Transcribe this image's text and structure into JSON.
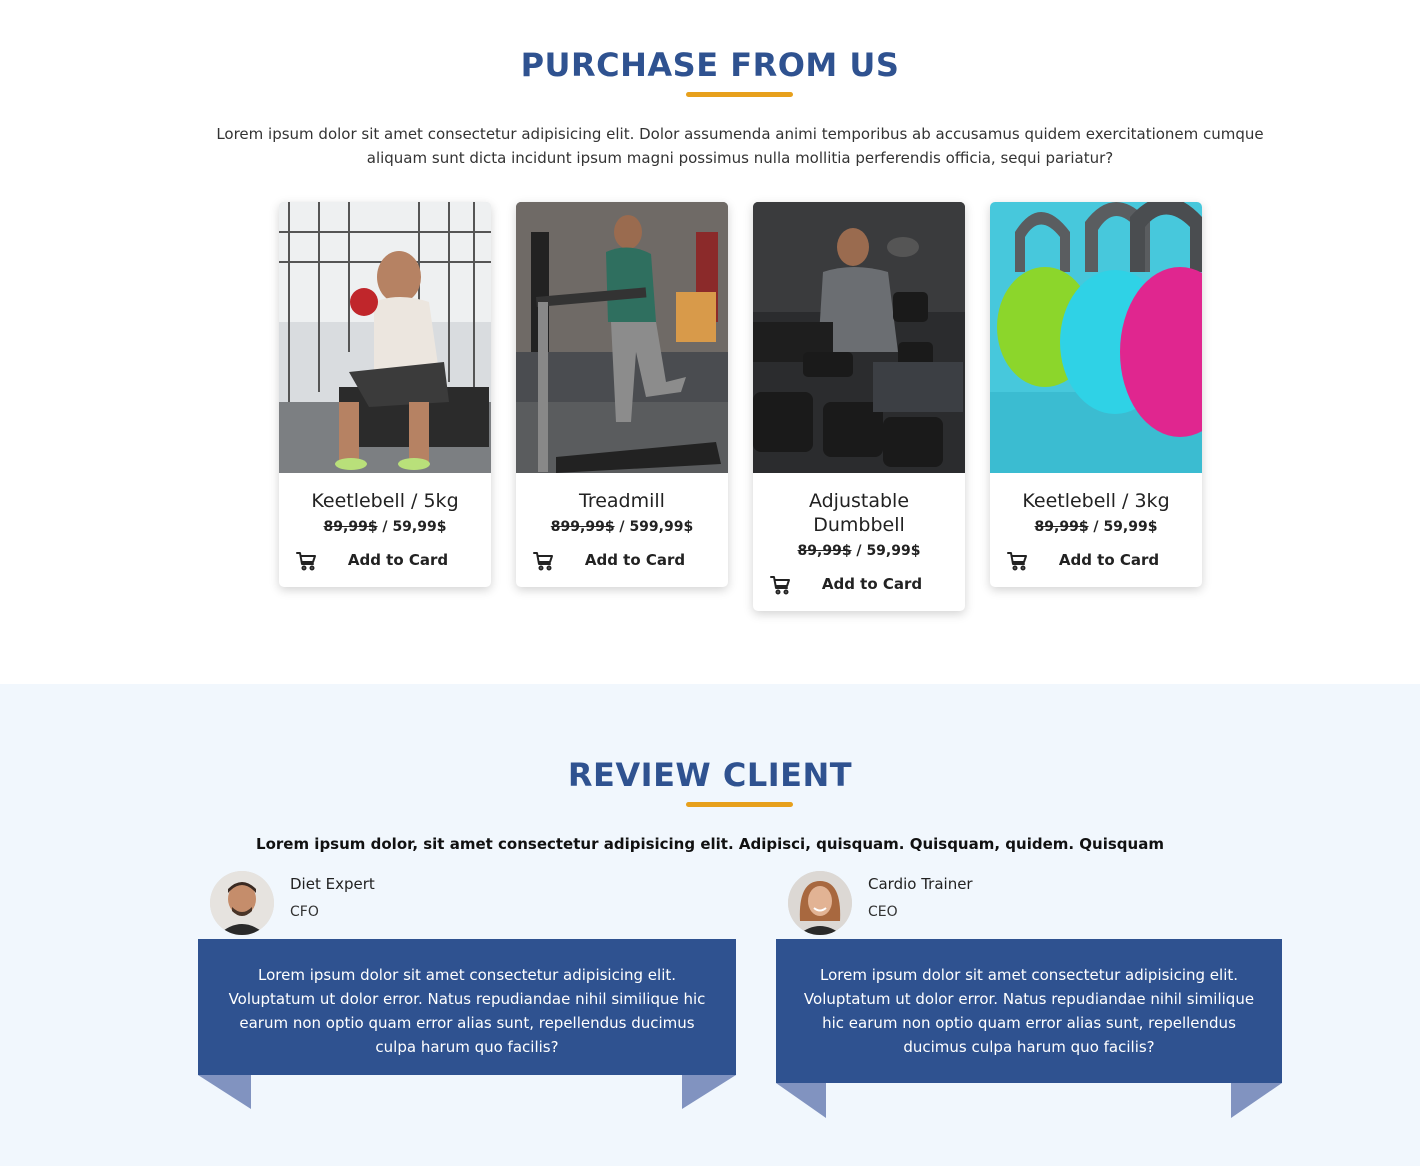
{
  "purchase": {
    "title": "PURCHASE FROM US",
    "intro": "Lorem ipsum dolor sit amet consectetur adipisicing elit. Dolor assumenda animi temporibus ab accusamus quidem exercitationem cumque aliquam sunt dicta incidunt ipsum magni possimus nulla mollitia perferendis officia, sequi pariatur?",
    "products": [
      {
        "name": "Keetlebell / 5kg",
        "old_price": "89,99$",
        "new_price": "59,99$",
        "button": "Add to Card"
      },
      {
        "name": "Treadmill",
        "old_price": "899,99$",
        "new_price": "599,99$",
        "button": "Add to Card"
      },
      {
        "name": "Adjustable Dumbbell",
        "old_price": "89,99$",
        "new_price": "59,99$",
        "button": "Add to Card"
      },
      {
        "name": "Keetlebell / 3kg",
        "old_price": "89,99$",
        "new_price": "59,99$",
        "button": "Add to Card"
      }
    ]
  },
  "review": {
    "title": "REVIEW CLIENT",
    "subtitle": "Lorem ipsum dolor, sit amet consectetur adipisicing elit. Adipisci, quisquam. Quisquam, quidem. Quisquam",
    "reviewers": [
      {
        "name": "Diet Expert",
        "role": "CFO",
        "text": "Lorem ipsum dolor sit amet consectetur adipisicing elit. Voluptatum ut dolor error. Natus repudiandae nihil similique hic earum non optio quam error alias sunt, repellendus ducimus culpa harum quo facilis?"
      },
      {
        "name": "Cardio Trainer",
        "role": "CEO",
        "text": "Lorem ipsum dolor sit amet consectetur adipisicing elit. Voluptatum ut dolor error. Natus repudiandae nihil similique hic earum non optio quam error alias sunt, repellendus ducimus culpa harum quo facilis?"
      }
    ]
  },
  "colors": {
    "heading": "#2f5290",
    "accent": "#e7a01c",
    "review_bg": "#f1f7fd",
    "bubble": "#2f5290",
    "ribbon": "#8193c0"
  }
}
